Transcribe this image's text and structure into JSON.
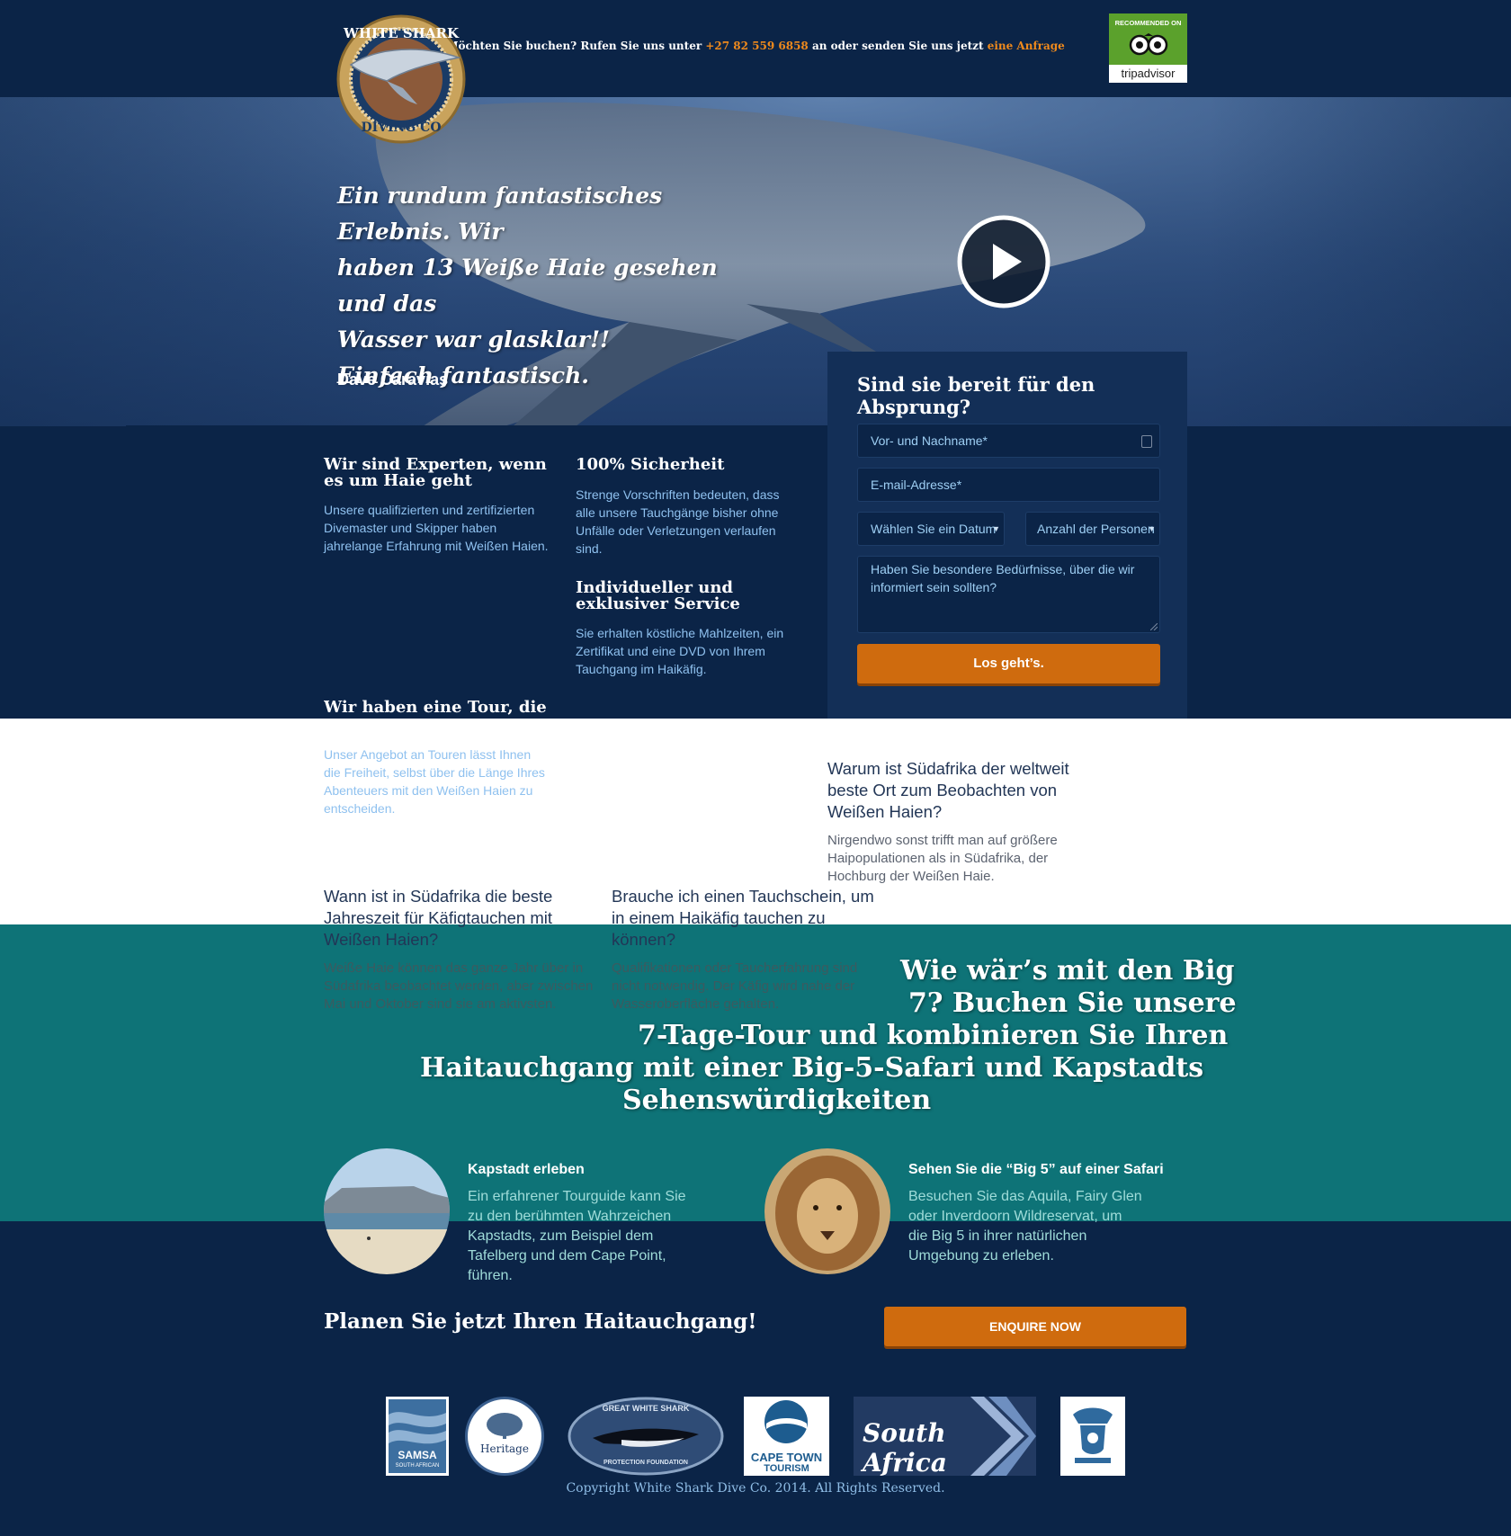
{
  "header": {
    "logo_text": "WHITE SHARK DIVING CO",
    "topbar_prefix": "Möchten Sie buchen? Rufen Sie uns unter",
    "phone": "+27 82 559 6858",
    "topbar_middle": "an oder senden Sie uns jetzt",
    "enquiry_link": "eine Anfrage",
    "tripadvisor_badge": "RECOMMENDED ON",
    "tripadvisor_name": "tripadvisor"
  },
  "hero": {
    "quote_lines": [
      "Ein rundum fantastisches Erlebnis. Wir",
      "haben 13 Weiße Haie gesehen und das",
      "Wasser war glasklar!!",
      "Einfach fantastisch."
    ],
    "author": "Dave Caravias",
    "play_icon": "play-icon"
  },
  "features": [
    {
      "title": "Wir sind Experten, wenn es um Haie geht",
      "text": "Unsere qualifizierten und zertifizierten Divemaster und Skipper haben jahrelange Erfahrung mit Weißen Haien."
    },
    {
      "title": "100% Sicherheit",
      "text": "Strenge Vorschriften bedeuten, dass alle unsere Tauchgänge bisher ohne Unfälle oder Verletzungen verlaufen sind."
    },
    {
      "title": "Individueller und exklusiver Service",
      "text": "Sie erhalten köstliche Mahlzeiten, ein Zertifikat und eine DVD von Ihrem Tauchgang im Haikäfig."
    },
    {
      "title": "Wir haben eine Tour, die",
      "text": "Unser Angebot an Touren lässt Ihnen die Freiheit, selbst über die Länge Ihres Abenteuers mit den Weißen Haien zu entscheiden."
    }
  ],
  "form": {
    "title": "Sind sie bereit für den Absprung?",
    "name_placeholder": "Vor- und Nachname*",
    "email_placeholder": "E-mail-Adresse*",
    "date_select": "Wählen Sie ein Datum",
    "persons_select": "Anzahl der Personen",
    "needs_placeholder": "Haben Sie besondere Bedürfnisse, über die wir informiert sein sollten?",
    "submit_label": "Los geht’s."
  },
  "faq": [
    {
      "title": "Warum ist Südafrika der weltweit beste Ort zum Beobachten von Weißen Haien?",
      "text": "Nirgendwo sonst trifft man auf größere Haipopulationen als in Südafrika, der Hochburg der Weißen Haie."
    },
    {
      "title": "Wann ist in Südafrika die beste Jahreszeit für Käfigtauchen mit Weißen Haien?",
      "text": "Weiße Haie können das ganze Jahr über in Südafrika beobachtet werden, aber zwischen Mai und Oktober sind sie am aktivsten."
    },
    {
      "title": "Brauche ich einen Tauchschein, um in einem Haikäfig tauchen zu können?",
      "text": "Qualifikationen oder Taucherfahrung sind nicht notwendig. Der Käfig wird nahe der Wasseroberfläche gehalten."
    }
  ],
  "big7": {
    "lines": [
      "Wie wär’s mit den Big",
      "7? Buchen Sie unsere",
      "7-Tage-Tour und kombinieren Sie Ihren",
      "Haitauchgang mit einer Big-5-Safari und Kapstadts",
      "Sehenswürdigkeiten"
    ]
  },
  "offers": [
    {
      "title": "Kapstadt erleben",
      "text": "Ein erfahrener Tourguide kann Sie zu den berühmten Wahrzeichen Kapstadts, zum Beispiel dem Tafelberg und dem Cape Point, führen."
    },
    {
      "title": "Sehen Sie die “Big 5” auf einer Safari",
      "text": "Besuchen Sie das Aquila, Fairy Glen oder Inverdoorn Wildreservat, um die Big 5 in ihrer natürlichen Umgebung zu erleben."
    }
  ],
  "cta": {
    "plan_text": "Planen Sie jetzt Ihren Haitauchgang!",
    "enquire_label": "ENQUIRE NOW"
  },
  "partners": {
    "samsa": "SAMSA",
    "samsa_sub": "SOUTH AFRICAN",
    "heritage": "Heritage",
    "gwspf_top": "GREAT WHITE SHARK",
    "gwspf_bottom": "PROTECTION FOUNDATION",
    "cape_town_1": "CAPE TOWN",
    "cape_town_2": "TOURISM",
    "south_africa": "South Africa"
  },
  "footer": {
    "copyright": "Copyright White Shark Dive Co. 2014. All Rights Reserved."
  },
  "colors": {
    "navy": "#0b2447",
    "accent_orange": "#cf6b0e",
    "link_orange": "#f08a1c",
    "teal": "#0e7377",
    "light_blue_text": "#8fc1ef",
    "tripadvisor_green": "#5ba12c"
  }
}
